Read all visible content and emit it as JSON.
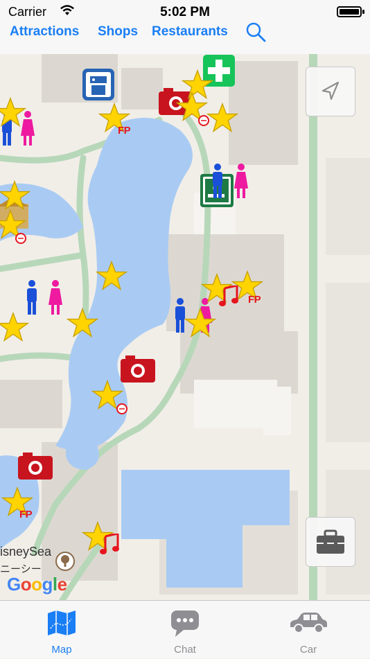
{
  "status_bar": {
    "carrier": "Carrier",
    "time": "5:02 PM",
    "icons": [
      "wifi-icon",
      "battery-icon"
    ]
  },
  "nav": {
    "links": [
      {
        "label": "Attractions"
      },
      {
        "label": "Shops"
      },
      {
        "label": "Restaurants"
      }
    ],
    "search_icon": "search-icon",
    "accent_color": "#1a7ef5"
  },
  "map": {
    "labels": {
      "place": "isneySea",
      "place_jp": "ニーシー",
      "google": "Google"
    },
    "marker_badge": "FP",
    "marker_types": [
      "attraction-star",
      "fastpass-star",
      "photo-spot",
      "restroom-male",
      "restroom-female",
      "smoking-area",
      "first-aid",
      "locker",
      "music-show"
    ],
    "controls": {
      "locate_icon": "location-arrow-icon",
      "toolbox_icon": "toolbox-icon"
    },
    "colors": {
      "water": "#a9cbf3",
      "path": "#b7d7b9",
      "building": "#dcd8d1",
      "star": "#ffd400",
      "badge": "#e6141e"
    }
  },
  "tabs": [
    {
      "label": "Map",
      "icon": "map-icon",
      "active": true
    },
    {
      "label": "Chat",
      "icon": "chat-icon",
      "active": false
    },
    {
      "label": "Car",
      "icon": "car-icon",
      "active": false
    }
  ]
}
